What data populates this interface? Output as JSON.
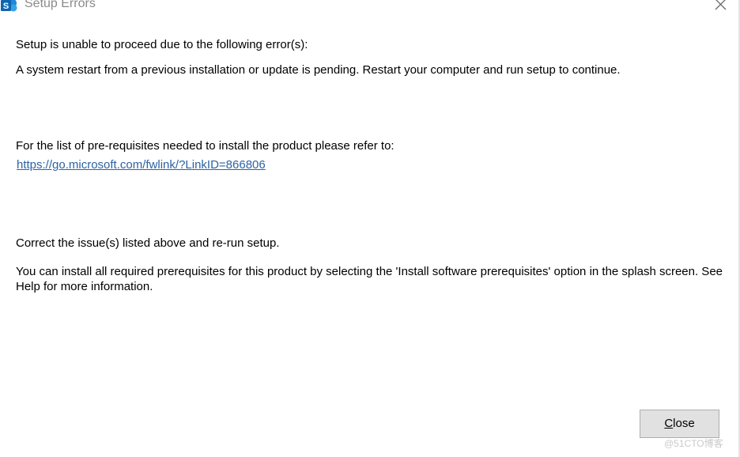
{
  "window": {
    "title": "Setup Errors"
  },
  "messages": {
    "heading": "Setup is unable to proceed due to the following error(s):",
    "error_1": "A system restart from a previous installation or update is pending. Restart your computer and run setup to continue.",
    "prereq_intro": "For the list of pre-requisites needed to install the product please refer to:",
    "prereq_link": "https://go.microsoft.com/fwlink/?LinkID=866806",
    "correct": "Correct the issue(s) listed above and re-run setup.",
    "install_info": "You can install all required prerequisites for this product by selecting the 'Install software prerequisites' option in the splash screen. See Help for more information."
  },
  "buttons": {
    "close_mnemonic": "C",
    "close_rest": "lose"
  },
  "watermark": "@51CTO博客",
  "icons": {
    "app": "sharepoint-icon",
    "close": "close-icon"
  },
  "colors": {
    "link": "#2c63a5",
    "title": "#8a8a8a",
    "app_icon": "#1a6fb5"
  }
}
